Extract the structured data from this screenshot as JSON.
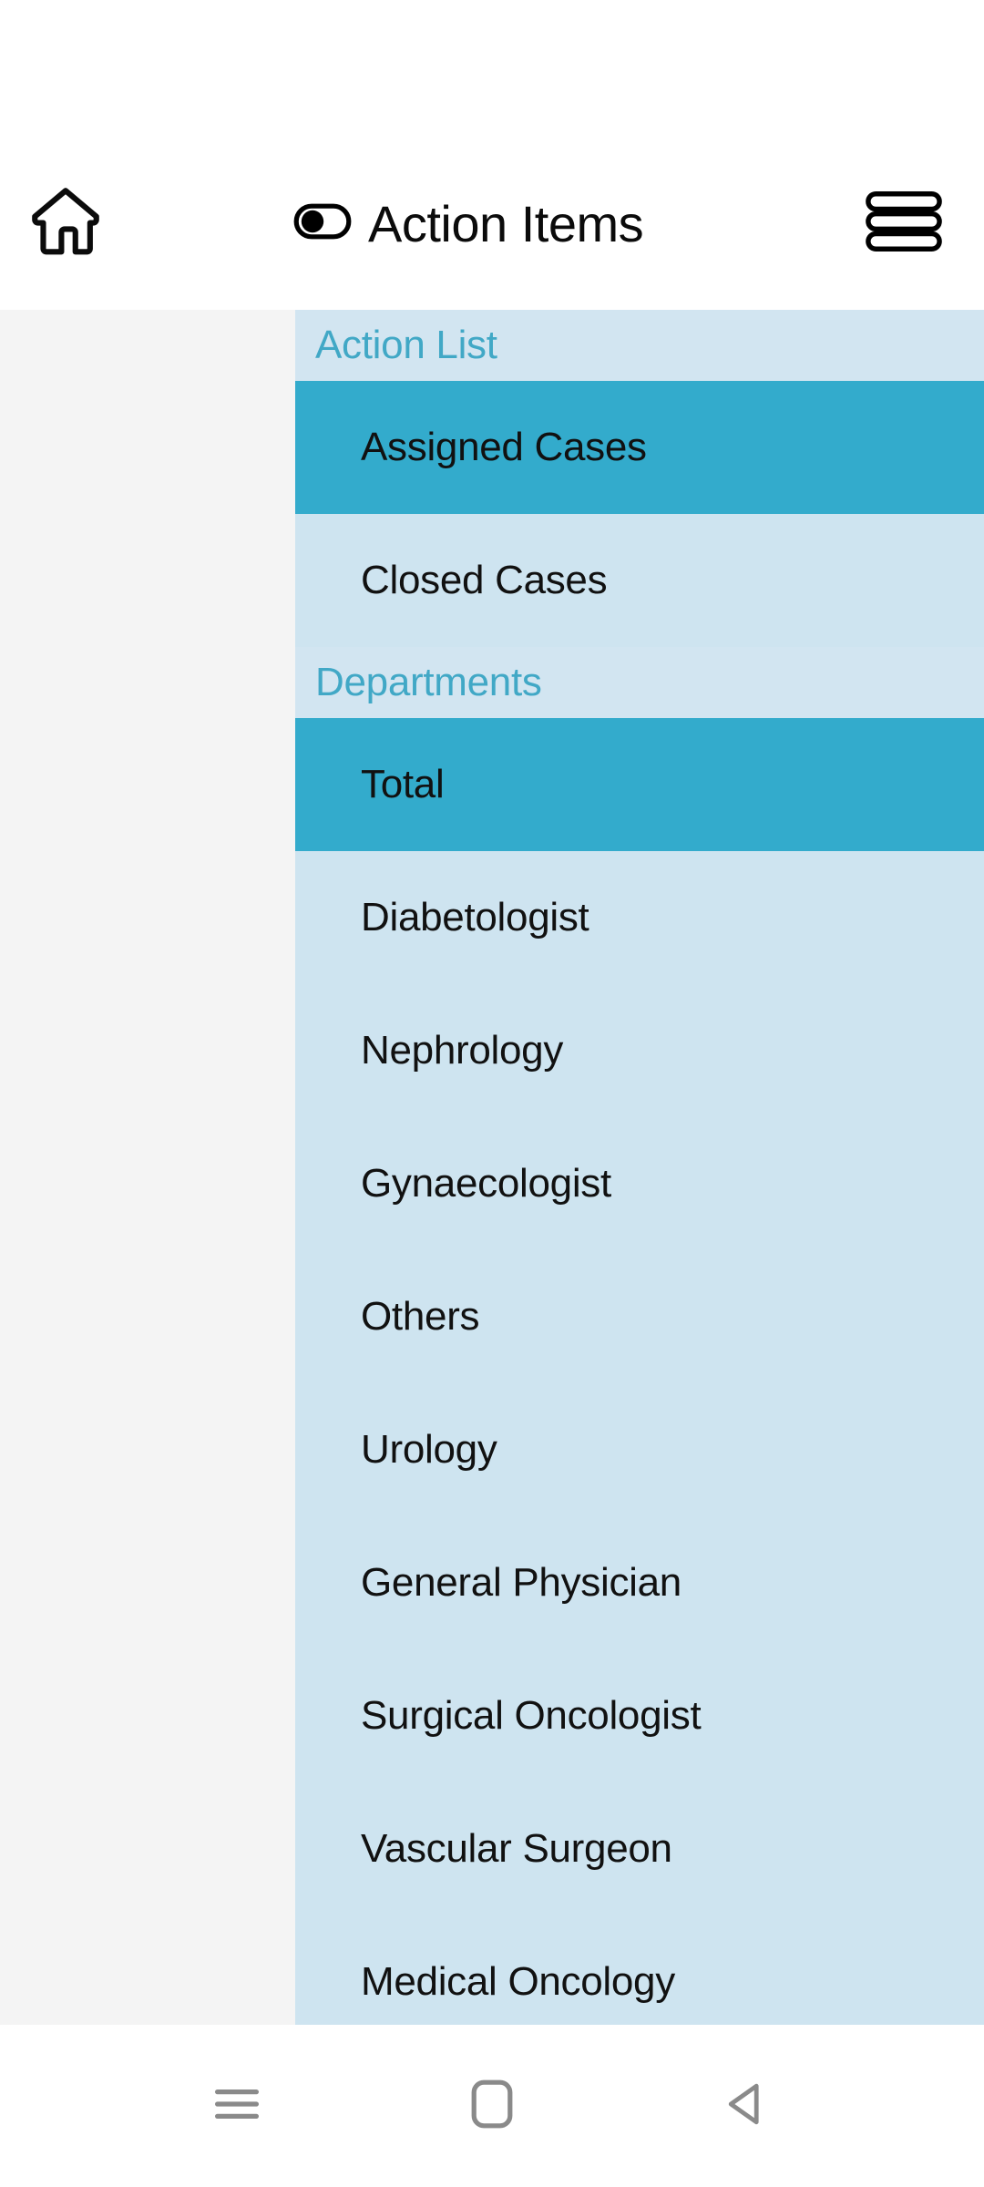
{
  "appbar": {
    "home_icon": "home-icon",
    "toggle_icon": "toggle-switch-icon",
    "title": "Action Items",
    "menu_icon": "hamburger-menu-icon"
  },
  "drawer": {
    "sections": [
      {
        "header": "Action List",
        "items": [
          {
            "label": "Assigned Cases",
            "selected": true
          },
          {
            "label": "Closed Cases",
            "selected": false
          }
        ]
      },
      {
        "header": "Departments",
        "items": [
          {
            "label": "Total",
            "selected": true
          },
          {
            "label": "Diabetologist",
            "selected": false
          },
          {
            "label": "Nephrology",
            "selected": false
          },
          {
            "label": "Gynaecologist",
            "selected": false
          },
          {
            "label": "Others",
            "selected": false
          },
          {
            "label": "Urology",
            "selected": false
          },
          {
            "label": "General Physician",
            "selected": false
          },
          {
            "label": "Surgical Oncologist",
            "selected": false
          },
          {
            "label": "Vascular Surgeon",
            "selected": false
          },
          {
            "label": "Medical Oncology",
            "selected": false
          }
        ]
      }
    ]
  },
  "navbar": {
    "recents_icon": "recents-icon",
    "home_icon": "home-square-icon",
    "back_icon": "back-triangle-icon"
  },
  "colors": {
    "accent": "#33abcc",
    "drawer_bg": "#cee4f0",
    "section_bg": "#d2e5f1",
    "section_text": "#41a8c6",
    "scrim": "#f4f4f4",
    "text": "#111111"
  }
}
